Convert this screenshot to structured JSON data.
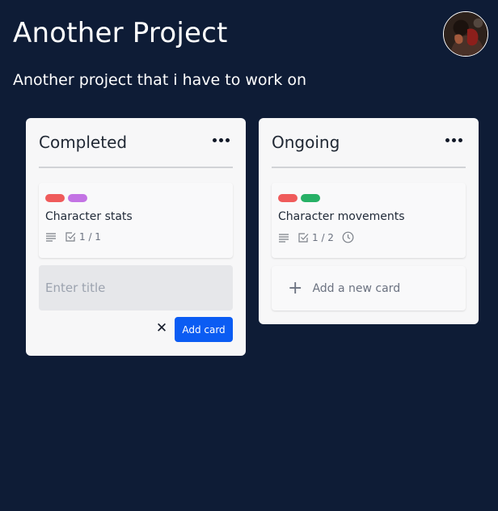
{
  "header": {
    "title": "Another Project",
    "subtitle": "Another project that i have to work on"
  },
  "lists": [
    {
      "title": "Completed",
      "card": {
        "labels": [
          "#ef5b5b",
          "#c373e4"
        ],
        "title": "Character stats",
        "checklist": "1 / 1",
        "icons": [
          "description-icon",
          "checklist-icon"
        ]
      },
      "new_card_form": {
        "placeholder": "Enter title",
        "submit_label": "Add card",
        "cancel_icon": "✕"
      }
    },
    {
      "title": "Ongoing",
      "card": {
        "labels": [
          "#ef5b5b",
          "#27b066"
        ],
        "title": "Character movements",
        "checklist": "1 / 2",
        "icons": [
          "description-icon",
          "checklist-icon",
          "clock-icon"
        ]
      },
      "add_new_card": {
        "icon": "+",
        "label": "Add a new card"
      }
    }
  ],
  "colors": {
    "background": "#0e1c36",
    "primary_button": "#0b5cf3"
  }
}
